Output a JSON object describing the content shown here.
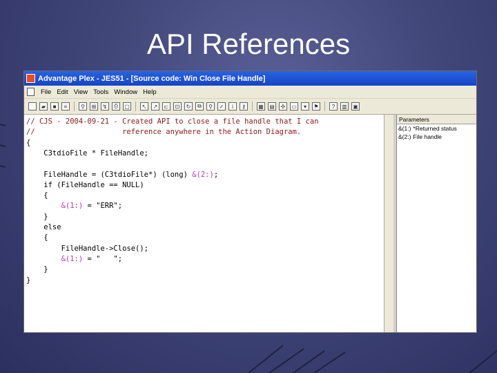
{
  "slide": {
    "title": "API References"
  },
  "window": {
    "title": "Advantage Plex - JES51 - [Source code: Win Close File Handle]",
    "menu": [
      "File",
      "Edit",
      "View",
      "Tools",
      "Window",
      "Help"
    ]
  },
  "code": {
    "lines": [
      {
        "text": "// CJS - 2004-09-21 - Created API to close a file handle that I can",
        "kind": "comment"
      },
      {
        "text": "//                    reference anywhere in the Action Diagram.",
        "kind": "comment"
      },
      {
        "text": "{",
        "kind": "normal"
      },
      {
        "text": "    C3tdioFile * FileHandle;",
        "kind": "normal"
      },
      {
        "text": "",
        "kind": "normal"
      },
      {
        "text": "    FileHandle = (C3tdioFile*) (long) &(2:);",
        "kind": "normal"
      },
      {
        "text": "    if (FileHandle == NULL)",
        "kind": "normal"
      },
      {
        "text": "    {",
        "kind": "normal"
      },
      {
        "text": "        &(1:) = \"ERR\";",
        "kind": "normal"
      },
      {
        "text": "    }",
        "kind": "normal"
      },
      {
        "text": "    else",
        "kind": "normal"
      },
      {
        "text": "    {",
        "kind": "normal"
      },
      {
        "text": "        FileHandle->Close();",
        "kind": "normal"
      },
      {
        "text": "        &(1:) = \"   \";",
        "kind": "normal"
      },
      {
        "text": "    }",
        "kind": "normal"
      },
      {
        "text": "}",
        "kind": "normal"
      }
    ]
  },
  "parameters": {
    "header": "Parameters",
    "items": [
      {
        "label": "&(1:)",
        "text": "*Returned status"
      },
      {
        "label": "&(2:)",
        "text": "File handle"
      }
    ]
  },
  "colors": {
    "titlebar": "#1d52d6",
    "comment": "#8b1a1a",
    "param_ref": "#b03ab0"
  }
}
